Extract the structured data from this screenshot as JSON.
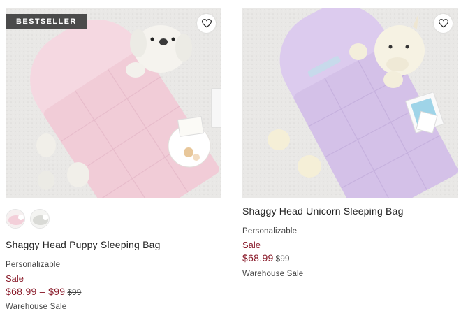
{
  "colors": {
    "sale": "#8a1c2b",
    "badge_bg": "#4b4b4b",
    "puppy_bag": "#f4d7df",
    "unicorn_bag": "#d9c8ec"
  },
  "products": [
    {
      "badge": "BESTSELLER",
      "favorite_icon": "heart-icon",
      "swatches": [
        "pink",
        "gray"
      ],
      "title": "Shaggy Head Puppy Sleeping Bag",
      "tag": "Personalizable",
      "sale_label": "Sale",
      "price": "$68.99 – $99",
      "was_price": "$99",
      "extra": "Warehouse Sale"
    },
    {
      "favorite_icon": "heart-icon",
      "title": "Shaggy Head Unicorn Sleeping Bag",
      "tag": "Personalizable",
      "sale_label": "Sale",
      "price": "$68.99",
      "was_price": "$99",
      "extra": "Warehouse Sale"
    }
  ]
}
